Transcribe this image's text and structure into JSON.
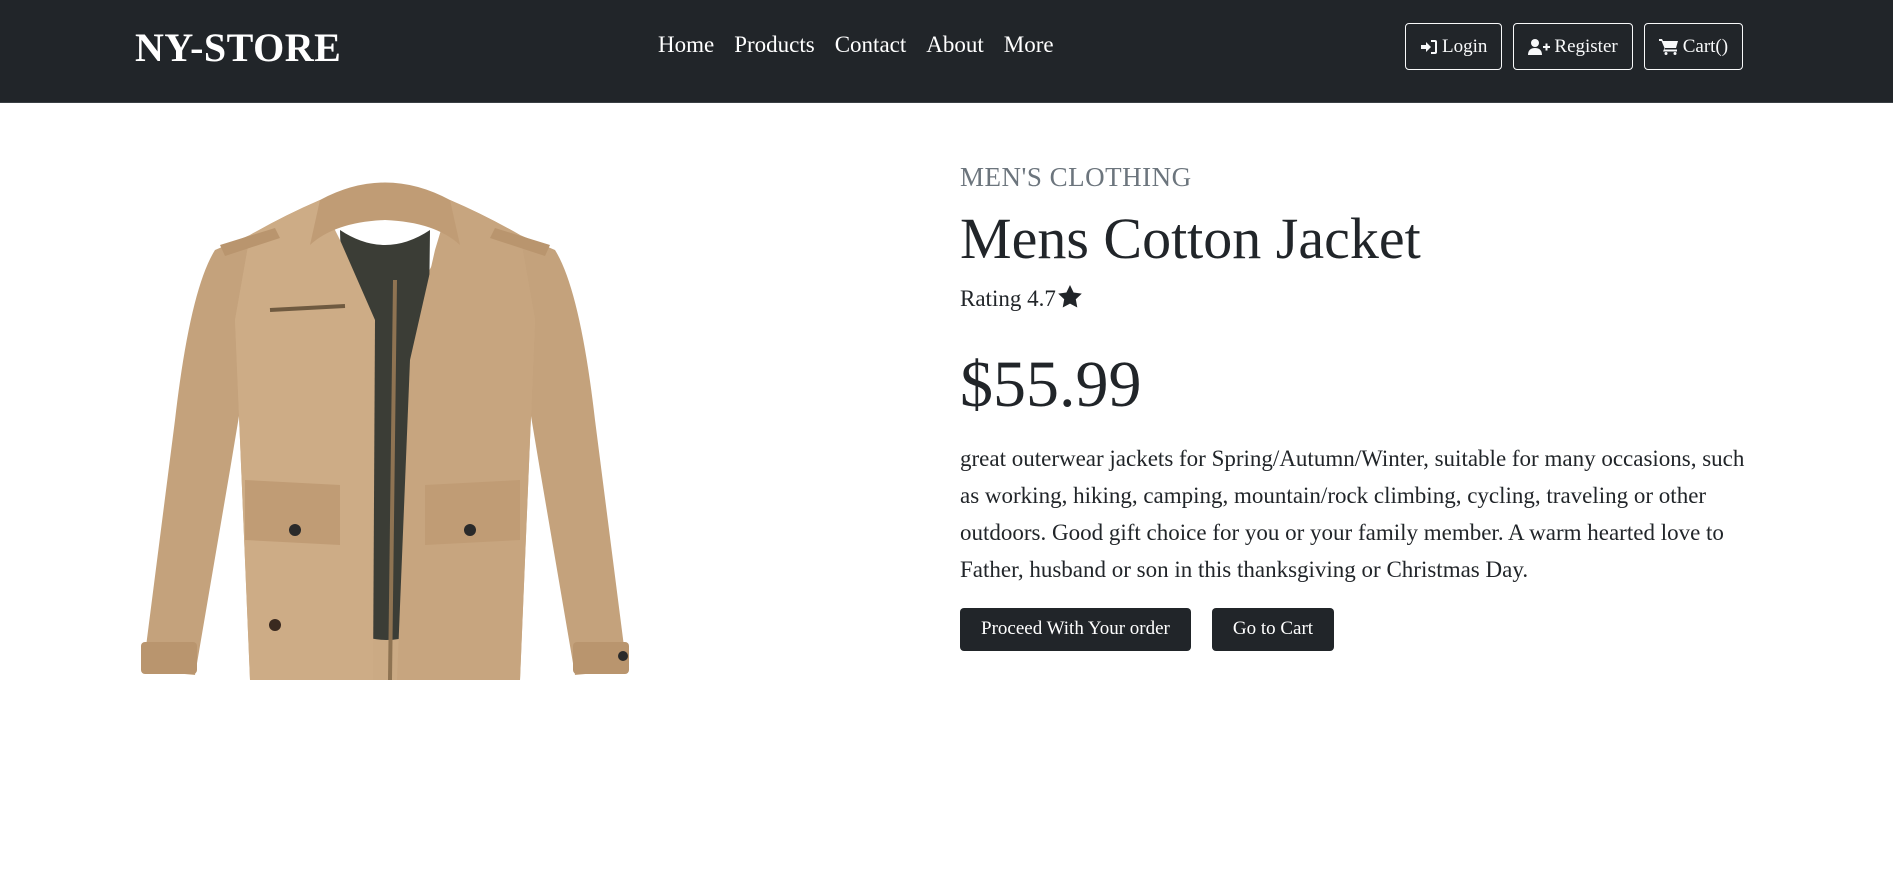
{
  "brand": "NY-STORE",
  "nav": {
    "links": [
      "Home",
      "Products",
      "Contact",
      "About",
      "More"
    ],
    "login_label": "Login",
    "register_label": "Register",
    "cart_label": "Cart()"
  },
  "product": {
    "image_alt": "Mens Cotton Jacket",
    "category": "MEN'S CLOTHING",
    "title": "Mens Cotton Jacket",
    "rating_label": "Rating 4.7",
    "rating_icon": "star-icon",
    "price": "$55.99",
    "description": "great outerwear jackets for Spring/Autumn/Winter, suitable for many occasions, such as working, hiking, camping, mountain/rock climbing, cycling, traveling or other outdoors. Good gift choice for you or your family member. A warm hearted love to Father, husband or son in this thanksgiving or Christmas Day.",
    "proceed_label": "Proceed With Your order",
    "cart_button_label": "Go to Cart"
  },
  "colors": {
    "navbar": "#212529",
    "jacket": "#C9A883",
    "lining": "#3B3D36",
    "muted": "#6c757d"
  },
  "icons": {
    "login": "sign-in-icon",
    "register": "user-plus-icon",
    "cart": "shopping-cart-icon"
  }
}
